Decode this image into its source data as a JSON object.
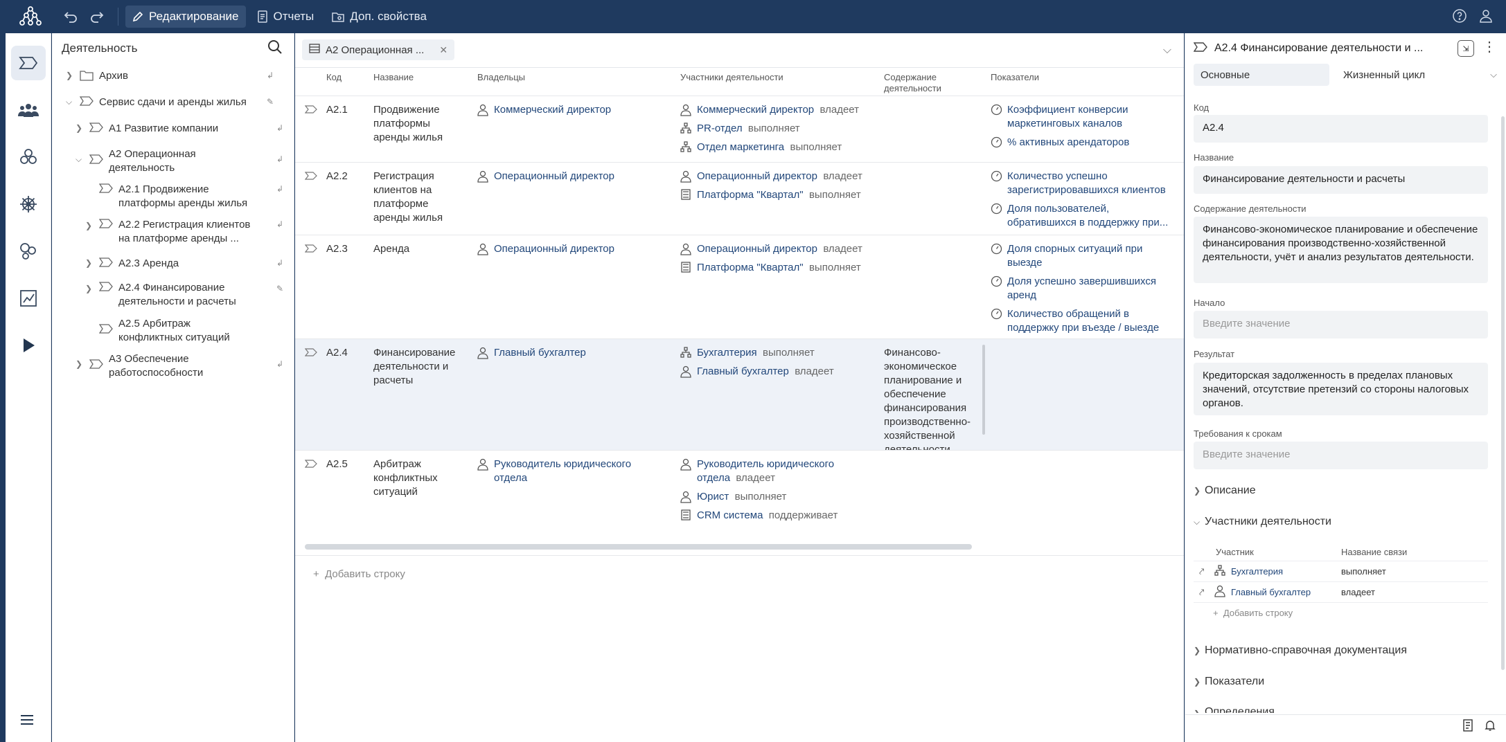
{
  "toolbar": {
    "undo_icon": "undo-icon",
    "redo_icon": "redo-icon",
    "edit_label": "Редактирование",
    "reports_label": "Отчеты",
    "props_label": "Доп. свойства"
  },
  "tree": {
    "title": "Деятельность",
    "items": [
      {
        "label": "Архив"
      },
      {
        "label": "Сервис сдачи и аренды жилья"
      },
      {
        "label": "А1 Развитие компании"
      },
      {
        "label": "А2 Операционная деятельность"
      },
      {
        "label": "А2.1 Продвижение платформы аренды жилья"
      },
      {
        "label": "А2.2 Регистрация клиентов на платформе аренды ..."
      },
      {
        "label": "А2.3 Аренда"
      },
      {
        "label": "А2.4 Финансирование деятельности и расчеты"
      },
      {
        "label": "А2.5 Арбитраж конфликтных ситуаций"
      },
      {
        "label": "А3 Обеспечение работоспособности"
      }
    ]
  },
  "main": {
    "tab_label": "А2 Операционная ...",
    "columns": [
      "Код",
      "Название",
      "Владельцы",
      "Участники деятельности",
      "Содержание деятельности",
      "Показатели"
    ],
    "rows": [
      {
        "code": "А2.1",
        "name": "Продвижение платформы аренды жилья",
        "owner": "Коммерческий директор",
        "participants": [
          {
            "name": "Коммерческий директор",
            "role": "владеет"
          },
          {
            "name": "PR-отдел",
            "role": "выполняет"
          },
          {
            "name": "Отдел маркетинга",
            "role": "выполняет"
          }
        ],
        "content": "",
        "indicators": [
          "Коэффициент конверсии маркетинговых каналов",
          "% активных арендаторов"
        ]
      },
      {
        "code": "А2.2",
        "name": "Регистрация клиентов на платформе аренды жилья",
        "owner": "Операционный директор",
        "participants": [
          {
            "name": "Операционный директор",
            "role": "владеет"
          },
          {
            "name": "Платформа \"Квартал\"",
            "role": "выполняет"
          }
        ],
        "content": "",
        "indicators": [
          "Количество успешно зарегистрировавшихся клиентов",
          "Доля пользователей, обратившихся в поддержку при..."
        ]
      },
      {
        "code": "А2.3",
        "name": "Аренда",
        "owner": "Операционный директор",
        "participants": [
          {
            "name": "Операционный директор",
            "role": "владеет"
          },
          {
            "name": "Платформа \"Квартал\"",
            "role": "выполняет"
          }
        ],
        "content": "",
        "indicators": [
          "Доля спорных ситуаций при выезде",
          "Доля успешно завершившихся аренд",
          "Количество обращений в поддержку при въезде / выезде"
        ]
      },
      {
        "code": "А2.4",
        "name": "Финансирование деятельности и расчеты",
        "owner": "Главный бухгалтер",
        "participants": [
          {
            "name": "Бухгалтерия",
            "role": "выполняет"
          },
          {
            "name": "Главный бухгалтер",
            "role": "владеет"
          }
        ],
        "content": "Финансово-экономическое планирование и обеспечение финансирования производственно-хозяйственной деятельности",
        "indicators": []
      },
      {
        "code": "А2.5",
        "name": "Арбитраж конфликтных ситуаций",
        "owner": "Руководитель юридического отдела",
        "participants": [
          {
            "name": "Руководитель юридического отдела",
            "role": "владеет"
          },
          {
            "name": "Юрист",
            "role": "выполняет"
          },
          {
            "name": "CRM система",
            "role": "поддерживает"
          }
        ],
        "content": "",
        "indicators": []
      }
    ],
    "add_row": "Добавить строку"
  },
  "panel": {
    "title": "А2.4 Финансирование деятельности и ...",
    "tabs": [
      "Основные",
      "Жизненный цикл"
    ],
    "code_label": "Код",
    "code_value": "А2.4",
    "name_label": "Название",
    "name_value": "Финансирование деятельности и расчеты",
    "content_label": "Содержание деятельности",
    "content_value": "Финансово-экономическое планирование и обеспечение финансирования производственно-хозяйственной деятельности, учёт и анализ результатов деятельности.",
    "start_label": "Начало",
    "start_placeholder": "Введите значение",
    "result_label": "Результат",
    "result_value": "Кредиторская задолженность в пределах плановых значений, отсутствие претензий со стороны налоговых органов.",
    "deadline_label": "Требования к срокам",
    "deadline_placeholder": "Введите значение",
    "sections": {
      "description": "Описание",
      "participants": "Участники деятельности",
      "docs": "Нормативно-справочная документация",
      "indicators": "Показатели",
      "cut": "Определения"
    },
    "participants_table": {
      "col_participant": "Участник",
      "col_relation": "Название связи",
      "rows": [
        {
          "name": "Бухгалтерия",
          "relation": "выполняет"
        },
        {
          "name": "Главный бухгалтер",
          "relation": "владеет"
        }
      ],
      "add_row": "Добавить строку"
    }
  }
}
